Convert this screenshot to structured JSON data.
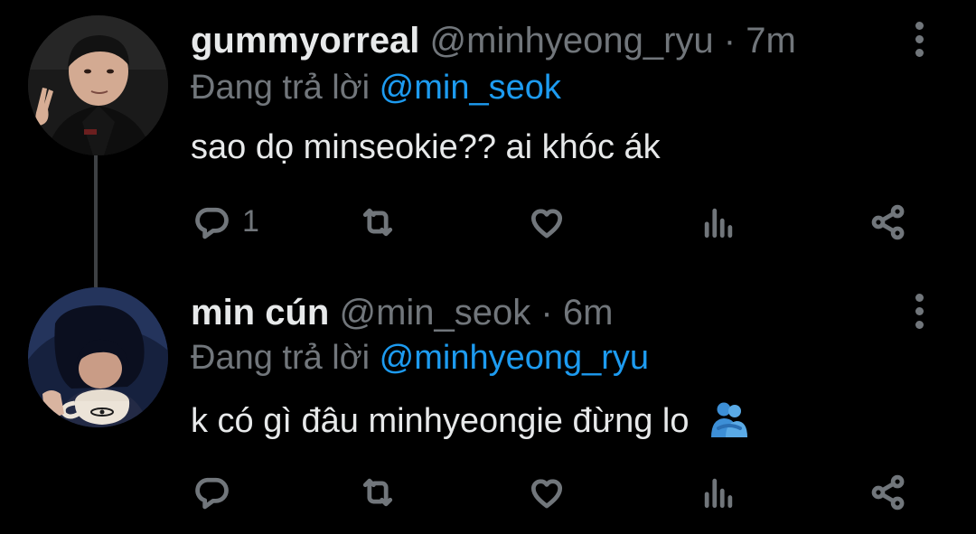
{
  "colors": {
    "background": "#000000",
    "primary_text": "#e7e9ea",
    "secondary_text": "#71767b",
    "accent": "#1d9bf0"
  },
  "tweets": [
    {
      "display_name": "gummyorreal",
      "handle": "@minhyeong_ryu",
      "separator": "·",
      "time": "7m",
      "reply_prefix": "Đang trả lời",
      "reply_to": "@min_seok",
      "text": "sao dọ minseokie?? ai khóc ák",
      "emoji": "",
      "actions": {
        "reply_icon": "reply-icon",
        "reply_count": "1",
        "retweet_icon": "retweet-icon",
        "like_icon": "heart-icon",
        "views_icon": "views-icon",
        "share_icon": "share-icon"
      },
      "more_icon": "more-vertical-icon"
    },
    {
      "display_name": "min cún",
      "handle": "@min_seok",
      "separator": "·",
      "time": "6m",
      "reply_prefix": "Đang trả lời",
      "reply_to": "@minhyeong_ryu",
      "text": "k có gì đâu minhyeongie đừng lo",
      "emoji": "people-hugging-emoji",
      "actions": {
        "reply_icon": "reply-icon",
        "reply_count": "",
        "retweet_icon": "retweet-icon",
        "like_icon": "heart-icon",
        "views_icon": "views-icon",
        "share_icon": "share-icon"
      },
      "more_icon": "more-vertical-icon"
    }
  ]
}
